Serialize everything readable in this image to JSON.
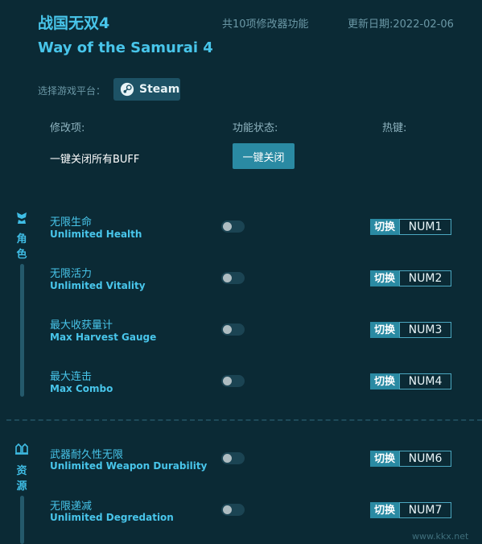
{
  "header": {
    "title_cn": "战国无双4",
    "title_en": "Way of the Samurai 4",
    "feature_count": "共10项修改器功能",
    "update_date": "更新日期:2022-02-06"
  },
  "platform": {
    "label": "选择游戏平台：",
    "button": "Steam"
  },
  "columns": {
    "item": "修改项:",
    "status": "功能状态:",
    "hotkey": "热键:"
  },
  "global": {
    "buff_label": "一键关闭所有BUFF",
    "close_button": "一键关闭"
  },
  "sections": [
    {
      "label": "角色",
      "features": [
        {
          "cn": "无限生命",
          "en": "Unlimited Health",
          "switch": "切换",
          "key": "NUM1",
          "on": false
        },
        {
          "cn": "无限活力",
          "en": "Unlimited Vitality",
          "switch": "切换",
          "key": "NUM2",
          "on": false
        },
        {
          "cn": "最大收获量计",
          "en": "Max Harvest Gauge",
          "switch": "切换",
          "key": "NUM3",
          "on": false
        },
        {
          "cn": "最大连击",
          "en": "Max Combo",
          "switch": "切换",
          "key": "NUM4",
          "on": false
        }
      ]
    },
    {
      "label": "资源",
      "features": [
        {
          "cn": "武器耐久性无限",
          "en": "Unlimited Weapon Durability",
          "switch": "切换",
          "key": "NUM6",
          "on": false
        },
        {
          "cn": "无限递减",
          "en": "Unlimited Degredation",
          "switch": "切换",
          "key": "NUM7",
          "on": false
        }
      ]
    }
  ],
  "watermark": "www.kkx.net"
}
